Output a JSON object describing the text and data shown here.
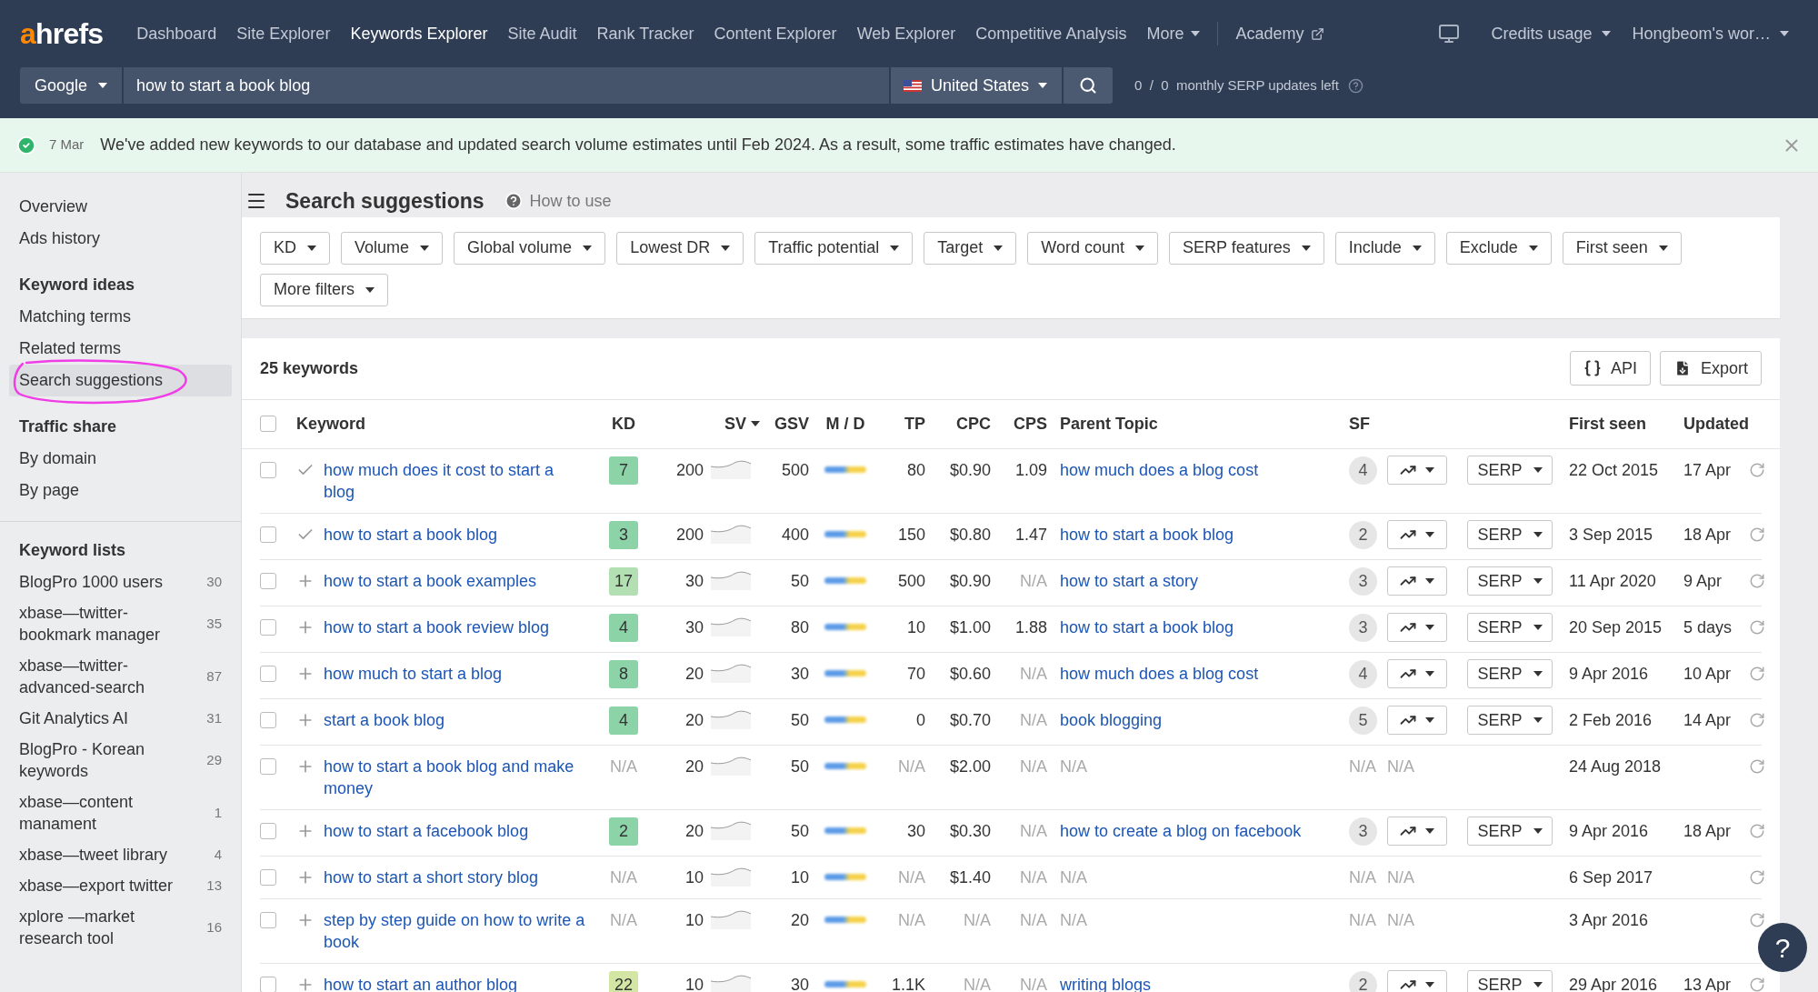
{
  "nav": {
    "logo": "ahrefs",
    "items": [
      {
        "label": "Dashboard",
        "selected": false,
        "kind": "link"
      },
      {
        "label": "Site Explorer",
        "selected": false,
        "kind": "link"
      },
      {
        "label": "Keywords Explorer",
        "selected": true,
        "kind": "link"
      },
      {
        "label": "Site Audit",
        "selected": false,
        "kind": "link"
      },
      {
        "label": "Rank Tracker",
        "selected": false,
        "kind": "link"
      },
      {
        "label": "Content Explorer",
        "selected": false,
        "kind": "link"
      },
      {
        "label": "Web Explorer",
        "selected": false,
        "kind": "link"
      },
      {
        "label": "Competitive Analysis",
        "selected": false,
        "kind": "link"
      },
      {
        "label": "More",
        "selected": false,
        "kind": "dropdown"
      },
      {
        "label": "Academy",
        "selected": false,
        "kind": "external"
      }
    ],
    "right": [
      {
        "label": "Credits usage"
      },
      {
        "label": "Hongbeom's wor…"
      }
    ]
  },
  "search": {
    "engine": "Google",
    "query": "how to start a book blog",
    "country": "United States",
    "quota": "0  /  0  monthly SERP updates left"
  },
  "banner": {
    "date": "7 Mar",
    "message": "We've added new keywords to our database and updated search volume estimates until Feb 2024. As a result, some traffic estimates have changed."
  },
  "sidebar": {
    "sections": [
      {
        "items": [
          {
            "label": "Overview",
            "selected": false
          },
          {
            "label": "Ads history",
            "selected": false
          }
        ]
      },
      {
        "title": "Keyword ideas",
        "items": [
          {
            "label": "Matching terms",
            "selected": false
          },
          {
            "label": "Related terms",
            "selected": false
          },
          {
            "label": "Search suggestions",
            "selected": true
          }
        ]
      },
      {
        "title": "Traffic share",
        "items": [
          {
            "label": "By domain",
            "selected": false
          },
          {
            "label": "By page",
            "selected": false
          }
        ]
      }
    ],
    "lists_title": "Keyword lists",
    "lists": [
      {
        "label": "BlogPro 1000 users",
        "count": "30"
      },
      {
        "label": "xbase—twitter-bookmark manager",
        "count": "35"
      },
      {
        "label": "xbase—twitter-advanced-search",
        "count": "87"
      },
      {
        "label": "Git Analytics AI",
        "count": "31"
      },
      {
        "label": "BlogPro - Korean keywords",
        "count": "29"
      },
      {
        "label": "xbase—content manament",
        "count": "1"
      },
      {
        "label": "xbase—tweet library",
        "count": "4"
      },
      {
        "label": "xbase—export twitter",
        "count": "13"
      },
      {
        "label": "xplore —market research tool",
        "count": "16"
      }
    ]
  },
  "page": {
    "title": "Search suggestions",
    "help": "How to use"
  },
  "filters": [
    "KD",
    "Volume",
    "Global volume",
    "Lowest DR",
    "Traffic potential",
    "Target",
    "Word count",
    "SERP features",
    "Include",
    "Exclude",
    "First seen",
    "More filters"
  ],
  "table": {
    "count": "25 keywords",
    "select_all_checked": false,
    "buttons": [
      {
        "label": "API",
        "kind": "api"
      },
      {
        "label": "Export",
        "kind": "export"
      }
    ],
    "columns": [
      {
        "label": "Keyword",
        "sorted": false
      },
      {
        "label": "KD",
        "sorted": false
      },
      {
        "label": "SV",
        "sorted": true
      },
      {
        "label": "GSV",
        "sorted": false
      },
      {
        "label": "M / D",
        "sorted": false
      },
      {
        "label": "TP",
        "sorted": false
      },
      {
        "label": "CPC",
        "sorted": false
      },
      {
        "label": "CPS",
        "sorted": false
      },
      {
        "label": "Parent Topic",
        "sorted": false
      },
      {
        "label": "SF",
        "sorted": false
      },
      {
        "label": "First seen",
        "sorted": false
      },
      {
        "label": "Updated",
        "sorted": false
      }
    ],
    "rows": [
      {
        "added": true,
        "checked": false,
        "keyword": "how much does it cost to start a blog",
        "kd": {
          "kind": "score",
          "text": "7",
          "color": "#8dd3a8"
        },
        "sv": "200",
        "gsv": "500",
        "tp": "80",
        "cpc": "$0.90",
        "cps": "1.09",
        "parent": {
          "kind": "link",
          "text": "how much does a blog cost"
        },
        "sf": {
          "kind": "badge",
          "text": "4"
        },
        "tools": {
          "kind": "buttons",
          "serp": "SERP"
        },
        "first_seen": "22 Oct 2015",
        "updated": "17 Apr"
      },
      {
        "added": true,
        "checked": false,
        "keyword": "how to start a book blog",
        "kd": {
          "kind": "score",
          "text": "3",
          "color": "#8dd3a8"
        },
        "sv": "200",
        "gsv": "400",
        "tp": "150",
        "cpc": "$0.80",
        "cps": "1.47",
        "parent": {
          "kind": "link",
          "text": "how to start a book blog"
        },
        "sf": {
          "kind": "badge",
          "text": "2"
        },
        "tools": {
          "kind": "buttons",
          "serp": "SERP"
        },
        "first_seen": "3 Sep 2015",
        "updated": "18 Apr"
      },
      {
        "added": false,
        "checked": false,
        "keyword": "how to start a book examples",
        "kd": {
          "kind": "score",
          "text": "17",
          "color": "#b3e0b3"
        },
        "sv": "30",
        "gsv": "50",
        "tp": "500",
        "cpc": "$0.90",
        "cps": {
          "kind": "muted",
          "text": "N/A"
        },
        "parent": {
          "kind": "link",
          "text": "how to start a story"
        },
        "sf": {
          "kind": "badge",
          "text": "3"
        },
        "tools": {
          "kind": "buttons",
          "serp": "SERP"
        },
        "first_seen": "11 Apr 2020",
        "updated": "9 Apr"
      },
      {
        "added": false,
        "checked": false,
        "keyword": "how to start a book review blog",
        "kd": {
          "kind": "score",
          "text": "4",
          "color": "#8dd3a8"
        },
        "sv": "30",
        "gsv": "80",
        "tp": "10",
        "cpc": "$1.00",
        "cps": "1.88",
        "parent": {
          "kind": "link",
          "text": "how to start a book blog"
        },
        "sf": {
          "kind": "badge",
          "text": "3"
        },
        "tools": {
          "kind": "buttons",
          "serp": "SERP"
        },
        "first_seen": "20 Sep 2015",
        "updated": "5 days"
      },
      {
        "added": false,
        "checked": false,
        "keyword": "how much to start a blog",
        "kd": {
          "kind": "score",
          "text": "8",
          "color": "#8dd3a8"
        },
        "sv": "20",
        "gsv": "30",
        "tp": "70",
        "cpc": "$0.60",
        "cps": {
          "kind": "muted",
          "text": "N/A"
        },
        "parent": {
          "kind": "link",
          "text": "how much does a blog cost"
        },
        "sf": {
          "kind": "badge",
          "text": "4"
        },
        "tools": {
          "kind": "buttons",
          "serp": "SERP"
        },
        "first_seen": "9 Apr 2016",
        "updated": "10 Apr"
      },
      {
        "added": false,
        "checked": false,
        "keyword": "start a book blog",
        "kd": {
          "kind": "score",
          "text": "4",
          "color": "#8dd3a8"
        },
        "sv": "20",
        "gsv": "50",
        "tp": "0",
        "cpc": "$0.70",
        "cps": {
          "kind": "muted",
          "text": "N/A"
        },
        "parent": {
          "kind": "link",
          "text": "book blogging"
        },
        "sf": {
          "kind": "badge",
          "text": "5"
        },
        "tools": {
          "kind": "buttons",
          "serp": "SERP"
        },
        "first_seen": "2 Feb 2016",
        "updated": "14 Apr"
      },
      {
        "added": false,
        "checked": false,
        "keyword": "how to start a book blog and make money",
        "kd": {
          "kind": "muted",
          "text": "N/A"
        },
        "sv": "20",
        "gsv": "50",
        "tp": {
          "kind": "muted",
          "text": "N/A"
        },
        "cpc": "$2.00",
        "cps": {
          "kind": "muted",
          "text": "N/A"
        },
        "parent": {
          "kind": "muted",
          "text": "N/A"
        },
        "sf": {
          "kind": "muted",
          "text": "N/A"
        },
        "tools": {
          "kind": "muted",
          "text": "N/A"
        },
        "first_seen": "24 Aug 2018"
      },
      {
        "added": false,
        "checked": false,
        "keyword": "how to start a facebook blog",
        "kd": {
          "kind": "score",
          "text": "2",
          "color": "#8dd3a8"
        },
        "sv": "20",
        "gsv": "50",
        "tp": "30",
        "cpc": "$0.30",
        "cps": {
          "kind": "muted",
          "text": "N/A"
        },
        "parent": {
          "kind": "link",
          "text": "how to create a blog on facebook"
        },
        "sf": {
          "kind": "badge",
          "text": "3"
        },
        "tools": {
          "kind": "buttons",
          "serp": "SERP"
        },
        "first_seen": "9 Apr 2016",
        "updated": "18 Apr"
      },
      {
        "added": false,
        "checked": false,
        "keyword": "how to start a short story blog",
        "kd": {
          "kind": "muted",
          "text": "N/A"
        },
        "sv": "10",
        "gsv": "10",
        "tp": {
          "kind": "muted",
          "text": "N/A"
        },
        "cpc": "$1.40",
        "cps": {
          "kind": "muted",
          "text": "N/A"
        },
        "parent": {
          "kind": "muted",
          "text": "N/A"
        },
        "sf": {
          "kind": "muted",
          "text": "N/A"
        },
        "tools": {
          "kind": "muted",
          "text": "N/A"
        },
        "first_seen": "6 Sep 2017"
      },
      {
        "added": false,
        "checked": false,
        "keyword": "step by step guide on how to write a book",
        "kd": {
          "kind": "muted",
          "text": "N/A"
        },
        "sv": "10",
        "gsv": "20",
        "tp": {
          "kind": "muted",
          "text": "N/A"
        },
        "cpc": {
          "kind": "muted",
          "text": "N/A"
        },
        "cps": {
          "kind": "muted",
          "text": "N/A"
        },
        "parent": {
          "kind": "muted",
          "text": "N/A"
        },
        "sf": {
          "kind": "muted",
          "text": "N/A"
        },
        "tools": {
          "kind": "muted",
          "text": "N/A"
        },
        "first_seen": "3 Apr 2016"
      },
      {
        "added": false,
        "checked": false,
        "keyword": "how to start an author blog",
        "kd": {
          "kind": "score",
          "text": "22",
          "color": "#d3e6a3"
        },
        "sv": "10",
        "gsv": "30",
        "tp": "1.1K",
        "cpc": {
          "kind": "muted",
          "text": "N/A"
        },
        "cps": {
          "kind": "muted",
          "text": "N/A"
        },
        "parent": {
          "kind": "link",
          "text": "writing blogs"
        },
        "sf": {
          "kind": "badge",
          "text": "2"
        },
        "tools": {
          "kind": "buttons",
          "serp": "SERP"
        },
        "first_seen": "29 Apr 2016",
        "updated": "13 Apr"
      }
    ]
  },
  "help_button": "?"
}
